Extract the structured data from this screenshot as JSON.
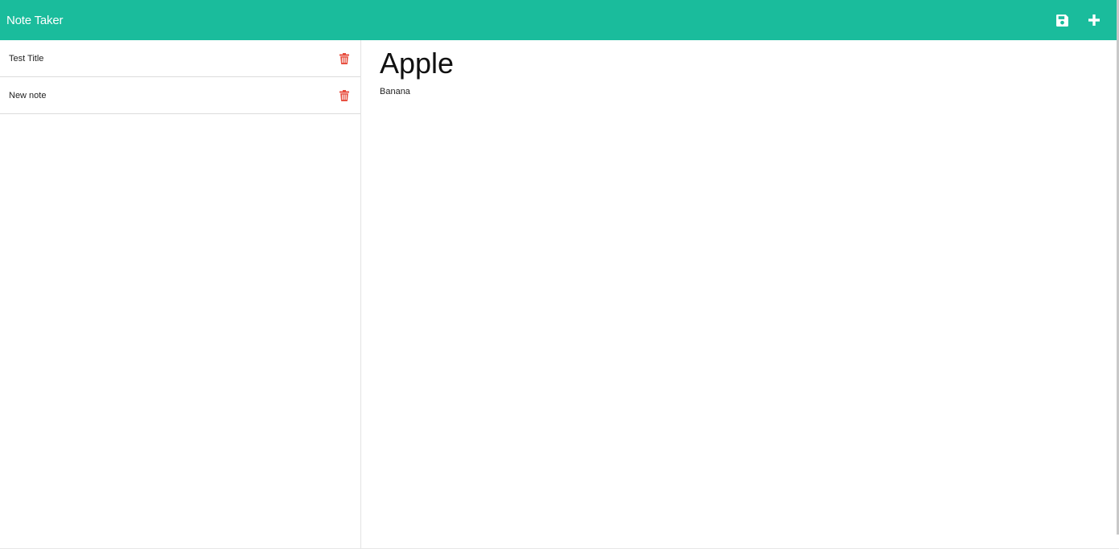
{
  "navbar": {
    "brand": "Note Taker",
    "save_icon": "floppy-disk-icon",
    "add_icon": "plus-icon",
    "color": "#1abc9c"
  },
  "sidebar": {
    "items": [
      {
        "label": "Test Title",
        "icon": "trash-icon"
      },
      {
        "label": "New note",
        "icon": "trash-icon"
      }
    ],
    "delete_color": "#e74c3c"
  },
  "note": {
    "title": "Apple",
    "text": "Banana"
  }
}
